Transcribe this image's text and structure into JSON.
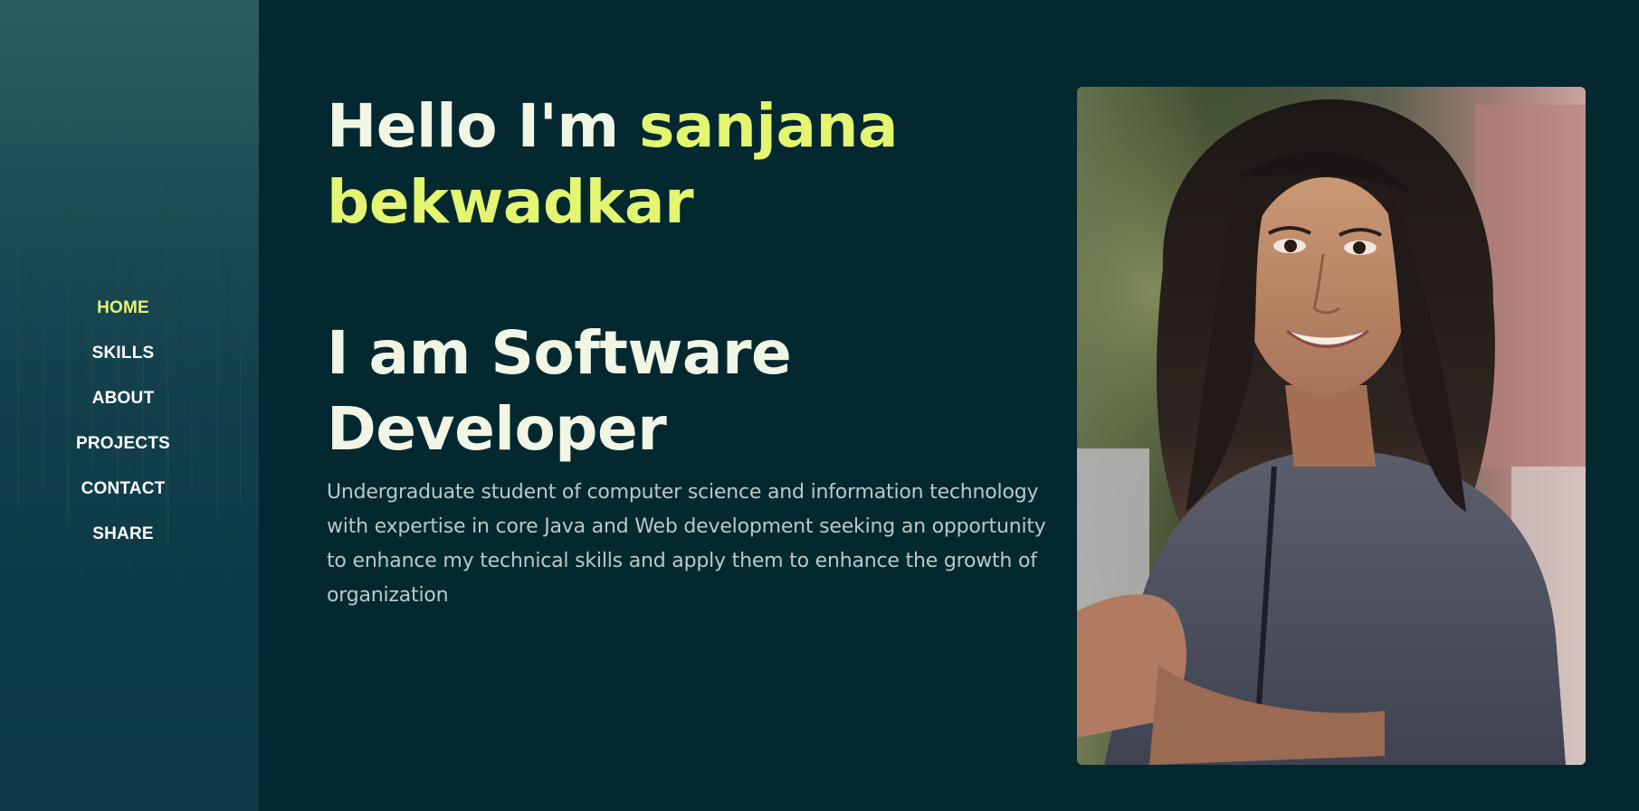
{
  "nav": {
    "items": [
      {
        "label": "HOME",
        "active": true
      },
      {
        "label": "SKILLS",
        "active": false
      },
      {
        "label": "ABOUT",
        "active": false
      },
      {
        "label": "PROJECTS",
        "active": false
      },
      {
        "label": "CONTACT",
        "active": false
      },
      {
        "label": "SHARE",
        "active": false
      }
    ]
  },
  "hero": {
    "greeting": "Hello I'm ",
    "name": "sanjana bekwadkar",
    "role": "I am Software Developer",
    "description": "Undergraduate student of computer science and information technology with expertise in core Java and Web development seeking an opportunity to enhance my technical skills and apply them to enhance the growth of organization"
  },
  "photo": {
    "icon": "profile-photo"
  },
  "colors": {
    "background": "#032830",
    "accent": "#e3f571",
    "heading": "#f1f5e3",
    "body_text": "#b9c9c7",
    "sidebar": "#0c3a45"
  }
}
